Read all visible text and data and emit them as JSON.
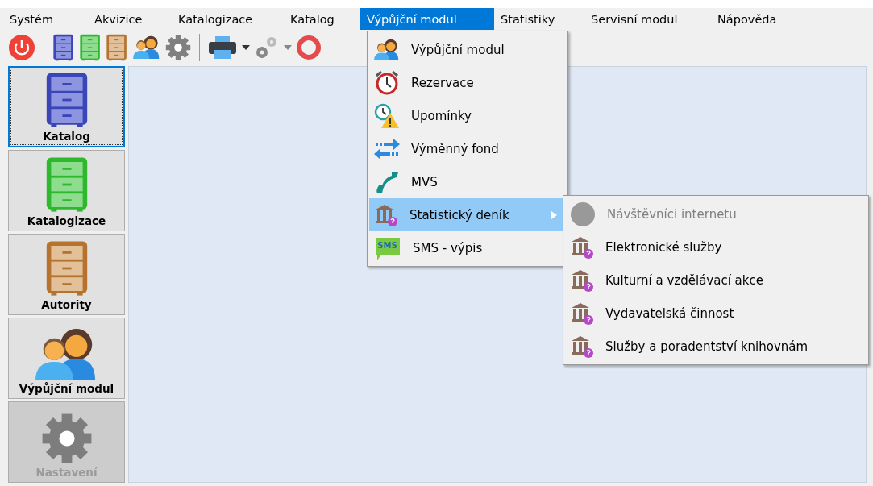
{
  "menubar": [
    {
      "label": "Systém",
      "selected": false
    },
    {
      "label": "Akvizice",
      "selected": false
    },
    {
      "label": "Katalogizace",
      "selected": false
    },
    {
      "label": "Katalog",
      "selected": false
    },
    {
      "label": "Výpůjční modul",
      "selected": true
    },
    {
      "label": "Statistiky",
      "selected": false
    },
    {
      "label": "Servisní modul",
      "selected": false
    },
    {
      "label": "Nápověda",
      "selected": false
    }
  ],
  "sidebar": {
    "items": [
      {
        "label": "Katalog",
        "kind": "blue-cabinet",
        "selected": true,
        "disabled": false
      },
      {
        "label": "Katalogizace",
        "kind": "green-cabinet",
        "selected": false,
        "disabled": false
      },
      {
        "label": "Autority",
        "kind": "brown-cabinet",
        "selected": false,
        "disabled": false
      },
      {
        "label": "Výpůjční modul",
        "kind": "people",
        "selected": false,
        "disabled": false
      },
      {
        "label": "Nastavení",
        "kind": "gear",
        "selected": false,
        "disabled": true
      }
    ]
  },
  "menu": {
    "items": [
      {
        "label": "Výpůjční modul",
        "kind": "people",
        "selected": false,
        "submenu": false
      },
      {
        "label": "Rezervace",
        "kind": "alarm",
        "selected": false,
        "submenu": false
      },
      {
        "label": "Upomínky",
        "kind": "warning",
        "selected": false,
        "submenu": false
      },
      {
        "label": "Výměnný fond",
        "kind": "arrows",
        "selected": false,
        "submenu": false
      },
      {
        "label": "MVS",
        "kind": "phone",
        "selected": false,
        "submenu": false
      },
      {
        "label": "Statistický deník",
        "kind": "bank",
        "selected": true,
        "submenu": true
      },
      {
        "label": "SMS - výpis",
        "kind": "sms",
        "icon_text": "SMS",
        "selected": false,
        "submenu": false
      }
    ]
  },
  "submenu": {
    "items": [
      {
        "label": "Návštěvníci internetu",
        "kind": "circle",
        "disabled": true
      },
      {
        "label": "Elektronické služby",
        "kind": "bank",
        "disabled": false
      },
      {
        "label": "Kulturní a vzdělávací akce",
        "kind": "bank",
        "disabled": false
      },
      {
        "label": "Vydavatelská činnost",
        "kind": "bank",
        "disabled": false
      },
      {
        "label": "Služby a poradentství knihovnám",
        "kind": "bank",
        "disabled": false
      }
    ]
  }
}
